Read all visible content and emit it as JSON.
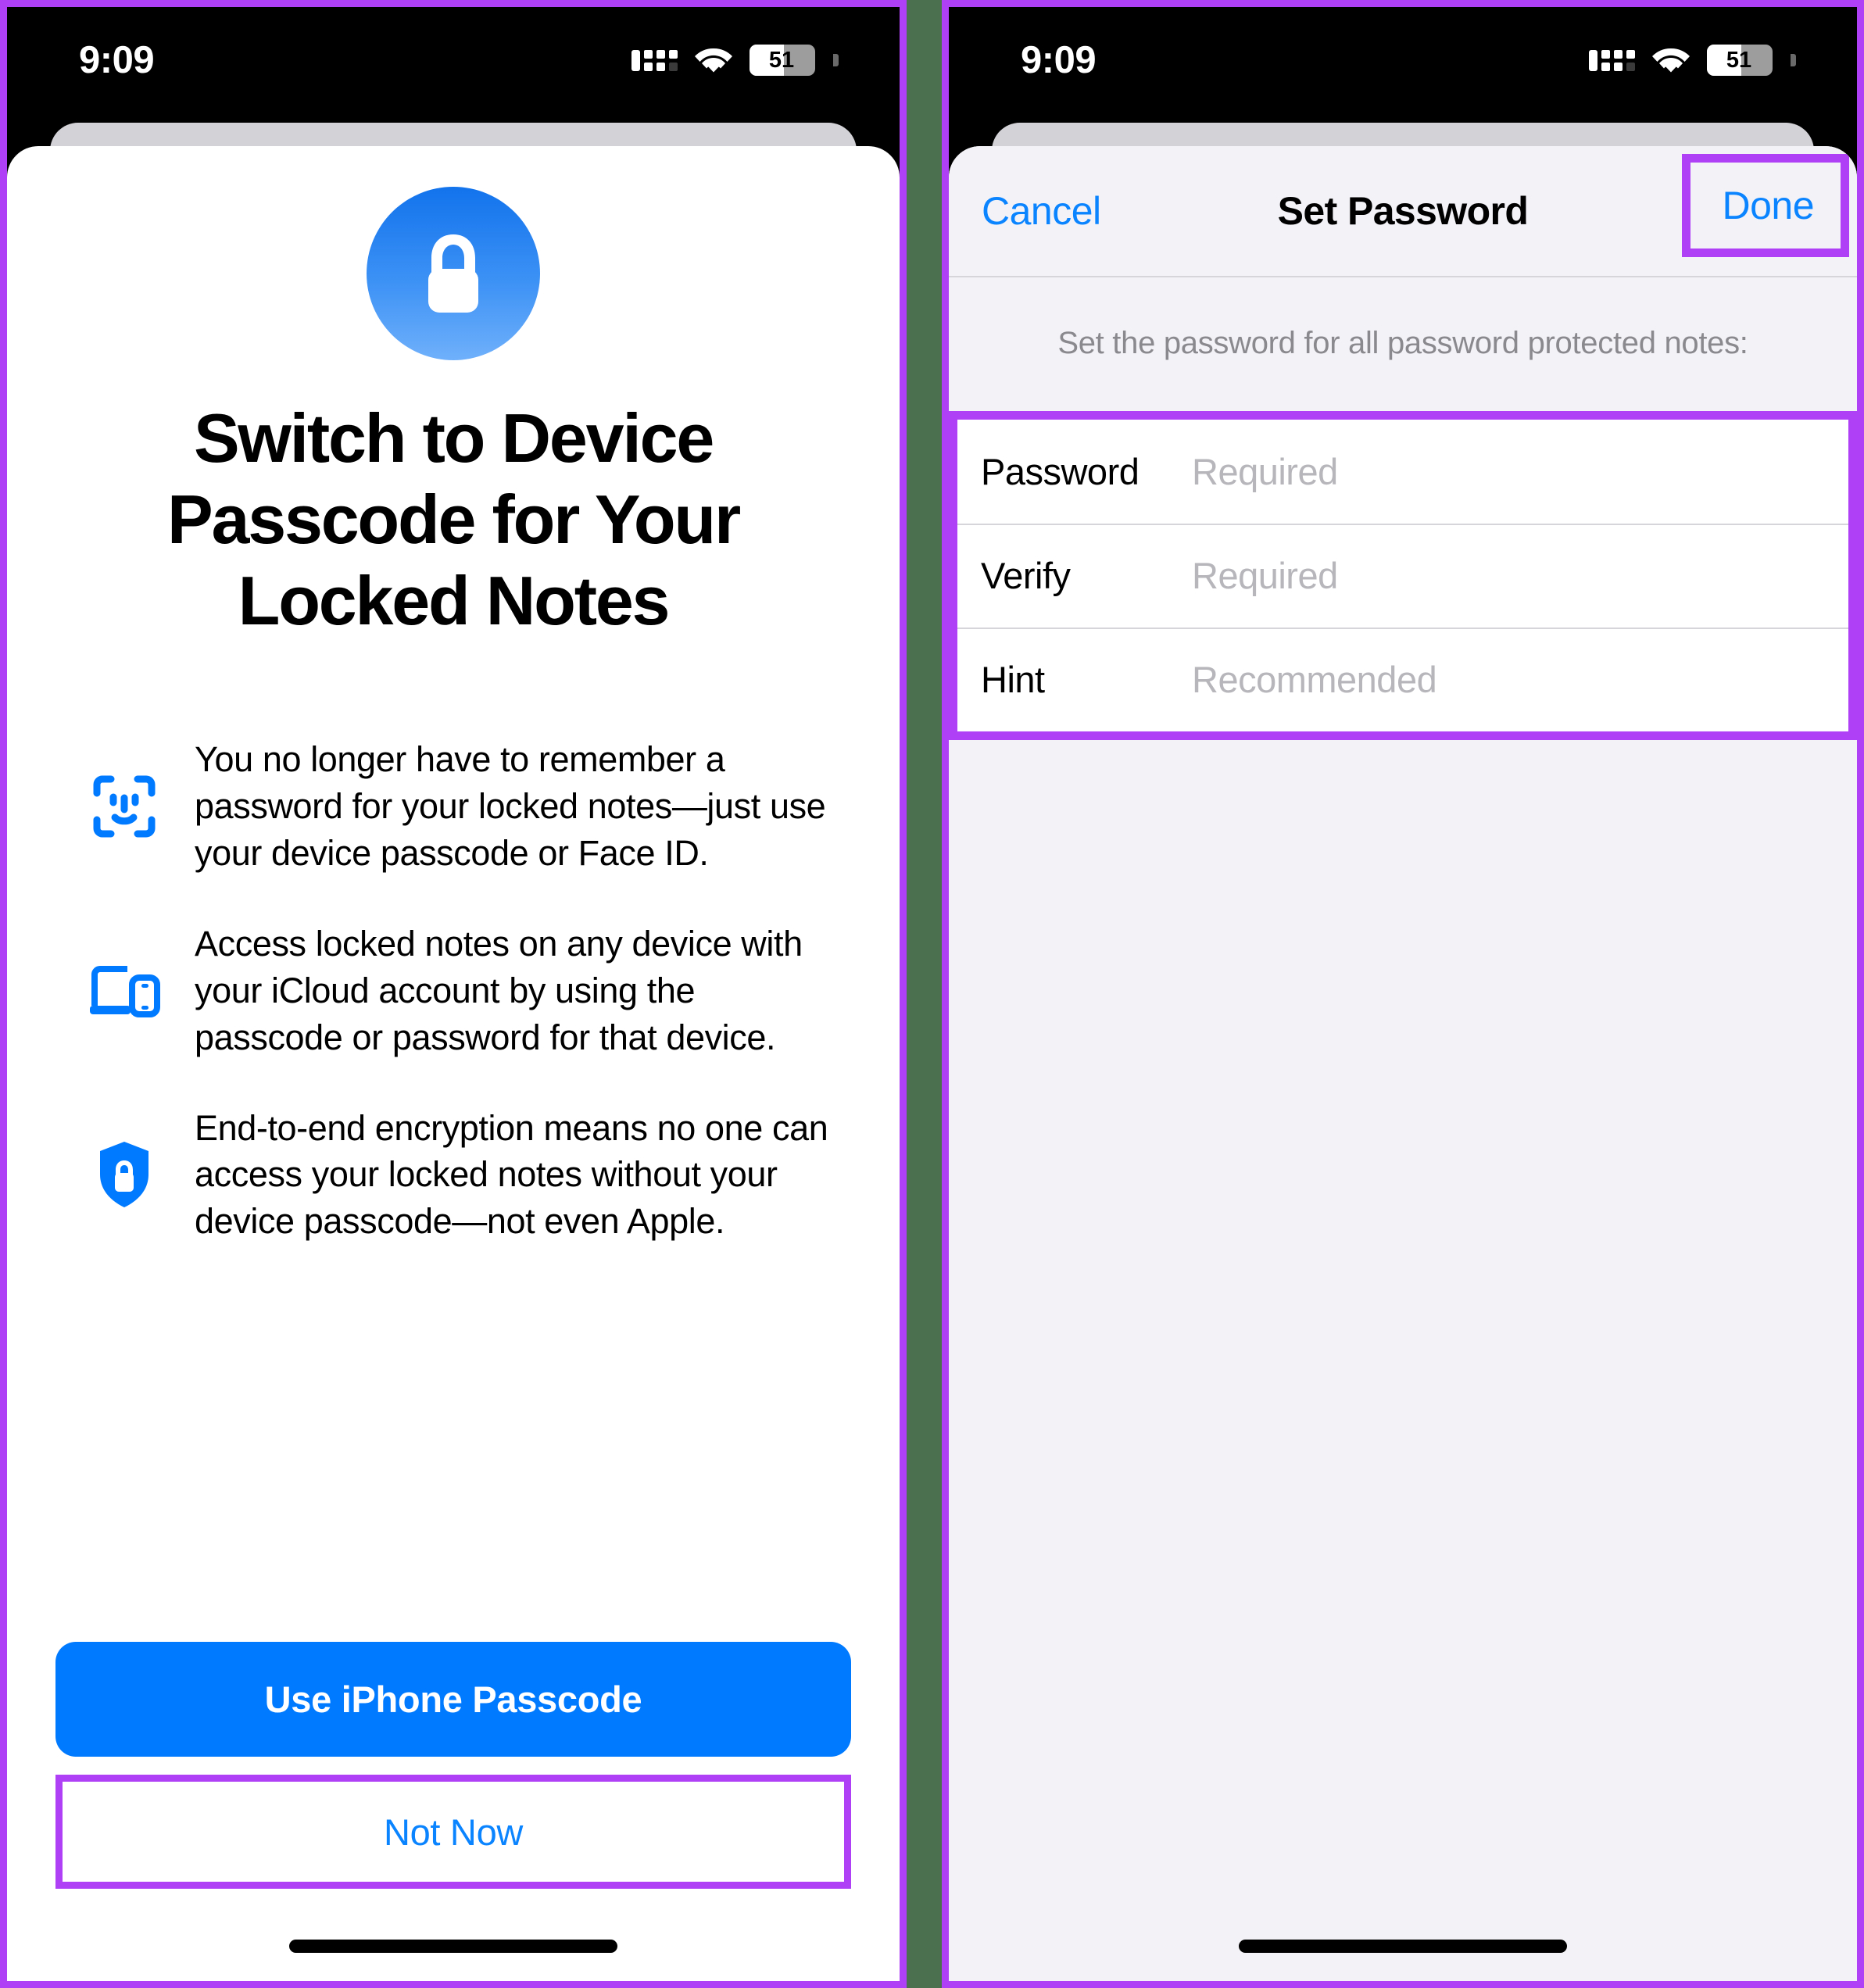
{
  "status_bar": {
    "time": "9:09",
    "battery_level": "51",
    "cellular_icon": "cellular-signal-icon",
    "wifi_icon": "wifi-icon",
    "battery_icon": "battery-icon"
  },
  "theme": {
    "accent_blue": "#007aff",
    "link_blue": "#0a84ff",
    "highlight_purple": "#b040f5",
    "sheet_gray": "#f2f2f7",
    "placeholder_gray": "#b6b6bb",
    "caption_gray": "#8a8a8e",
    "backdrop_green": "#4b7050"
  },
  "left_screen": {
    "hero_icon": "lock-badge-icon",
    "title": "Switch to Device Passcode for Your Locked Notes",
    "features": [
      {
        "icon": "face-id-icon",
        "text": "You no longer have to remember a password for your locked notes—just use your device passcode or Face ID."
      },
      {
        "icon": "devices-laptop-phone-icon",
        "text": "Access locked notes on any device with your iCloud account by using the passcode or password for that device."
      },
      {
        "icon": "shield-lock-icon",
        "text": "End-to-end encryption means no one can access your locked notes without your device passcode—not even Apple."
      }
    ],
    "primary_button": "Use iPhone Passcode",
    "secondary_button": "Not Now"
  },
  "right_screen": {
    "nav": {
      "cancel_label": "Cancel",
      "title": "Set Password",
      "done_label": "Done"
    },
    "caption": "Set the password for all password protected notes:",
    "fields": [
      {
        "label": "Password",
        "value": "",
        "placeholder": "Required"
      },
      {
        "label": "Verify",
        "value": "",
        "placeholder": "Required"
      },
      {
        "label": "Hint",
        "value": "",
        "placeholder": "Recommended"
      }
    ]
  }
}
